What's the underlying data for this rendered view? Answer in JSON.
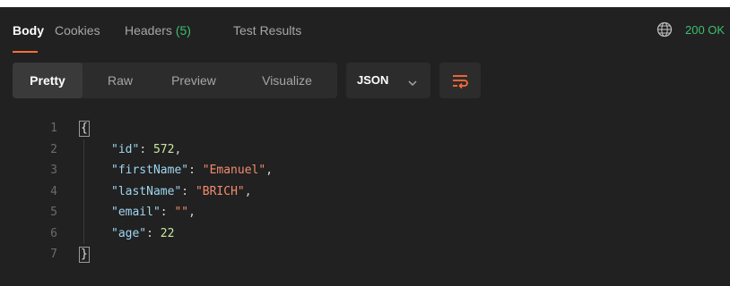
{
  "tabs": [
    {
      "label": "Body",
      "active": true
    },
    {
      "label": "Cookies"
    },
    {
      "label": "Headers",
      "count": "(5)"
    },
    {
      "label": "Test Results"
    }
  ],
  "status": {
    "code_text": "200 OK",
    "color": "#3bbf6e"
  },
  "view_modes": [
    {
      "label": "Pretty",
      "active": true
    },
    {
      "label": "Raw"
    },
    {
      "label": "Preview"
    },
    {
      "label": "Visualize"
    }
  ],
  "format": {
    "selected": "JSON"
  },
  "icons": {
    "globe": "globe-icon",
    "chevron": "chevron-down-icon",
    "wrap": "wrap-lines-icon"
  },
  "colors": {
    "accent": "#ff6c37",
    "background": "#212121",
    "success": "#3bbf6e"
  },
  "code_lines": [
    {
      "n": "1",
      "text": "{"
    },
    {
      "n": "2",
      "key": "\"id\"",
      "sep": ": ",
      "value": "572",
      "value_type": "number",
      "trail": ","
    },
    {
      "n": "3",
      "key": "\"firstName\"",
      "sep": ": ",
      "value": "\"Emanuel\"",
      "value_type": "string",
      "trail": ","
    },
    {
      "n": "4",
      "key": "\"lastName\"",
      "sep": ": ",
      "value": "\"BRICH\"",
      "value_type": "string",
      "trail": ","
    },
    {
      "n": "5",
      "key": "\"email\"",
      "sep": ": ",
      "value": "\"\"",
      "value_type": "string",
      "trail": ","
    },
    {
      "n": "6",
      "key": "\"age\"",
      "sep": ": ",
      "value": "22",
      "value_type": "number",
      "trail": ""
    },
    {
      "n": "7",
      "text": "}"
    }
  ]
}
